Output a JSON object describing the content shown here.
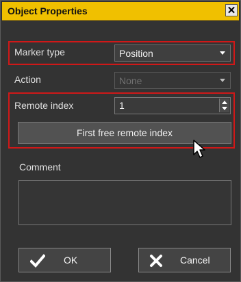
{
  "window": {
    "title": "Object Properties",
    "close_symbol": "✕",
    "titlebar_color": "#f0c000",
    "highlight_color": "#d01818"
  },
  "form": {
    "marker_type": {
      "label": "Marker type",
      "value": "Position",
      "icon": "chevron-down-icon"
    },
    "action": {
      "label": "Action",
      "value": "None",
      "disabled": true,
      "icon": "chevron-down-icon"
    },
    "remote_index": {
      "label": "Remote index",
      "value": "1"
    },
    "first_free_button": "First free remote index",
    "comment": {
      "label": "Comment",
      "value": ""
    }
  },
  "buttons": {
    "ok": {
      "label": "OK",
      "icon": "checkmark-icon"
    },
    "cancel": {
      "label": "Cancel",
      "icon": "x-icon"
    }
  },
  "cursor": {
    "icon": "mouse-pointer-icon"
  }
}
